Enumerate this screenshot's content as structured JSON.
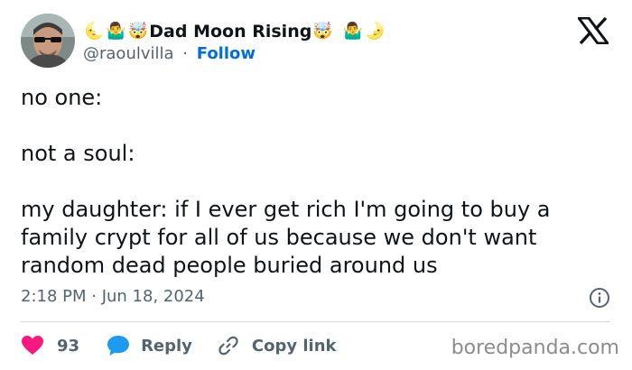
{
  "author": {
    "display_name": "Dad Moon Rising",
    "name_emojis_left": [
      "🌜",
      "🤷‍♂️",
      "🤯"
    ],
    "name_emojis_right": [
      "🤯",
      "🤷‍♂️",
      "🌛"
    ],
    "handle": "@raoulvilla",
    "separator": "·",
    "follow_label": "Follow"
  },
  "tweet": {
    "lines": [
      "no one:",
      "not a soul:",
      "my daughter: if I ever get rich I'm going to buy a\nfamily crypt for all of us because we don't want\nrandom dead people buried around us"
    ],
    "timestamp": "2:18 PM · Jun 18, 2024"
  },
  "actions": {
    "likes_count": "93",
    "reply_label": "Reply",
    "copy_link_label": "Copy link"
  },
  "watermark": "boredpanda.com",
  "colors": {
    "like": "#f91880",
    "reply": "#1d9bf0",
    "follow": "#006fd6",
    "secondary_text": "#536471"
  },
  "icons": {
    "platform": "x-logo-icon",
    "like": "heart-icon",
    "reply": "speech-bubble-icon",
    "copy": "link-icon",
    "info": "info-icon"
  }
}
